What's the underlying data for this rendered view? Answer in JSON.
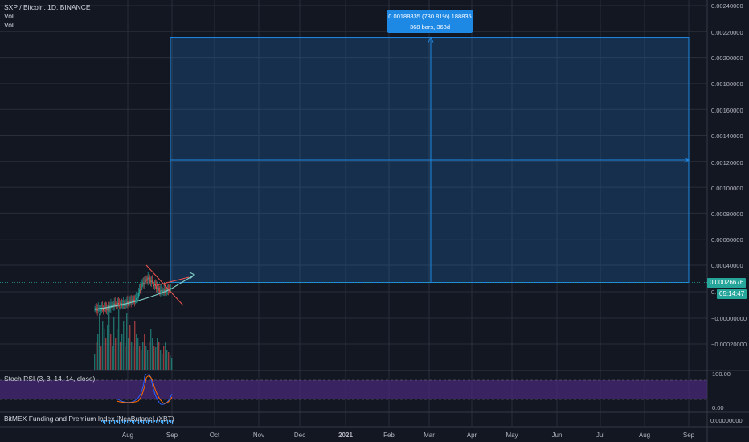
{
  "header": {
    "symbol_line": "SXP / Bitcoin, 1D, BINANCE",
    "indicator_1": "Vol",
    "indicator_2": "Vol"
  },
  "price_axis": {
    "labels": [
      "0.00240000",
      "0.00220000",
      "0.00200000",
      "0.00180000",
      "0.00160000",
      "0.00140000",
      "0.00120000",
      "0.00100000",
      "0.00080000",
      "0.00060000",
      "0.00040000",
      "0.",
      "−0.00000000",
      "−0.00020000"
    ],
    "current_price": "0.00026676",
    "countdown": "05:14:47"
  },
  "time_axis": {
    "labels": [
      "Aug",
      "Sep",
      "Oct",
      "Nov",
      "Dec",
      "2021",
      "Feb",
      "Mar",
      "Apr",
      "May",
      "Jun",
      "Jul",
      "Aug",
      "Sep"
    ]
  },
  "measure_tool": {
    "line1": "0.00188835 (730.81%) 188835",
    "line2": "368 bars, 368d"
  },
  "stoch_rsi": {
    "label": "Stoch RSI (3, 3, 14, 14, close)",
    "axis_top": "100.00",
    "axis_bottom": "0.00"
  },
  "bitmex": {
    "label": "BitMEX Funding and Premium Index [NeoButane] (XBT)",
    "axis_value": "0.00000000"
  },
  "colors": {
    "background": "#131722",
    "grid": "#2a2e39",
    "up": "#26a69a",
    "down": "#ef5350",
    "measure": "#1e88e5",
    "stoch_band": "#4a2a7a"
  },
  "chart_data": {
    "type": "line",
    "title": "SXP / Bitcoin, 1D, BINANCE",
    "price_series": [
      {
        "date": "Jul 21",
        "close": 6e-05
      },
      {
        "date": "Jul 24",
        "close": 6e-05
      },
      {
        "date": "Jul 27",
        "close": 6.5e-05
      },
      {
        "date": "Jul 30",
        "close": 9e-05
      },
      {
        "date": "Aug 2",
        "close": 0.0001
      },
      {
        "date": "Aug 5",
        "close": 9.5e-05
      },
      {
        "date": "Aug 8",
        "close": 0.00012
      },
      {
        "date": "Aug 11",
        "close": 0.000135
      },
      {
        "date": "Aug 14",
        "close": 0.00025
      },
      {
        "date": "Aug 17",
        "close": 0.0003
      },
      {
        "date": "Aug 20",
        "close": 0.00025
      },
      {
        "date": "Aug 23",
        "close": 0.0002
      },
      {
        "date": "Aug 26",
        "close": 0.0002
      },
      {
        "date": "Aug 29",
        "close": 0.00022
      }
    ],
    "ylim": [
      -0.0003,
      0.00245
    ],
    "yticks": [
      0.0024,
      0.0022,
      0.002,
      0.0018,
      0.0016,
      0.0014,
      0.0012,
      0.001,
      0.0008,
      0.0006,
      0.0004
    ],
    "current_price": 0.00026676,
    "measure_range": {
      "from_price": 0.00026676,
      "to_price": 0.00215511,
      "change": 0.00188835,
      "percent": 730.81,
      "bars": 368,
      "days": 368
    },
    "stoch_rsi_range": [
      0,
      100
    ],
    "grid": true
  }
}
